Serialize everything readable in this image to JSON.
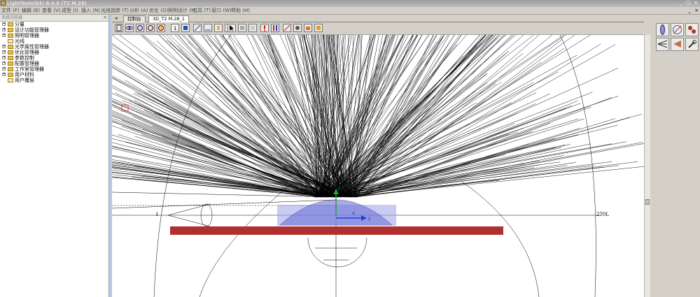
{
  "window": {
    "title": "LightTools(64) 8.4.0  (T2 M.28)",
    "controls": [
      "_",
      "□",
      "×"
    ]
  },
  "menu": {
    "items": [
      "文件 (F)",
      "编辑 (E)",
      "查看 (V)",
      "成型 (I)",
      "插入 (N)",
      "光线追踪 (T)",
      "分析 (A)",
      "优化 (O)",
      "照明设计 (M)",
      "工具 (T)",
      "窗口 (W)",
      "帮助 (H)"
    ],
    "right_controls": [
      "_",
      "×"
    ]
  },
  "left_panel": {
    "title": "系统浏览器",
    "close": "×",
    "tree": [
      {
        "label": "分量",
        "expandable": true
      },
      {
        "label": "设计功能管理器",
        "expandable": true
      },
      {
        "label": "照明管理器",
        "expandable": true
      },
      {
        "label": "光线",
        "expandable": false
      },
      {
        "label": "光学属性管理器",
        "expandable": true
      },
      {
        "label": "优化管理器",
        "expandable": true
      },
      {
        "label": "参数控制",
        "expandable": true
      },
      {
        "label": "配置管理器",
        "expandable": true
      },
      {
        "label": "工作室管理器",
        "expandable": true
      },
      {
        "label": "用户材料",
        "expandable": true
      },
      {
        "label": "用户覆层",
        "expandable": false
      }
    ]
  },
  "tabs": {
    "scroll_arrow": "◂",
    "items": [
      {
        "label": "控制台",
        "active": false
      },
      {
        "label": "3D_T2 M.28_1",
        "active": true
      }
    ],
    "right_controls": [
      "▸",
      "×"
    ]
  },
  "toolbar": {
    "buttons": [
      "print-icon",
      "eye-icon",
      "rotate-left-icon",
      "rotate-right-icon",
      "zoom-icon",
      "fit-icon",
      "info-icon",
      "axes-icon",
      "ruler-icon",
      "hand-icon",
      "undo-icon",
      "arrow-select-icon",
      "move-icon",
      "grid-icon",
      "error-icon",
      "flag-icon",
      "trace-icon",
      "bug-icon",
      "camera-icon",
      "save-view-icon"
    ]
  },
  "viewport": {
    "axis_label_left": "1",
    "axis_label_right": "270L",
    "axis_label_y": "y",
    "axis_label_z": "z",
    "axis_label_x": "x",
    "colors": {
      "rays": "#000000",
      "lens_fill": "#9aa0e8",
      "plate": "#b03030",
      "axis_y": "#20a040",
      "axis_z": "#2040e0",
      "marker": "#e04040"
    }
  },
  "right_panel": {
    "buttons": [
      "lens-icon",
      "analysis-icon",
      "trace-set-icon",
      "fan-icon",
      "cone-icon",
      "wrench-icon"
    ]
  }
}
